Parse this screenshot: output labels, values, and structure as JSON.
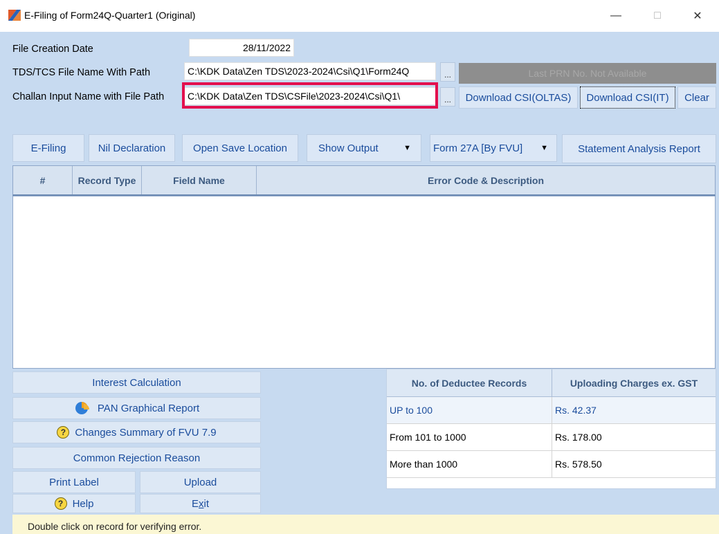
{
  "window": {
    "title": "E-Filing of Form24Q-Quarter1 (Original)",
    "min": "—",
    "max": "□",
    "close": "✕"
  },
  "form": {
    "file_creation_label": "File Creation Date",
    "file_creation_value": "28/11/2022",
    "tds_label": "TDS/TCS File Name With Path",
    "tds_value": "C:\\KDK Data\\Zen TDS\\2023-2024\\Csi\\Q1\\Form24Q",
    "challan_label": "Challan Input Name with File Path",
    "challan_value": "C:\\KDK Data\\Zen TDS\\CSFile\\2023-2024\\Csi\\Q1\\",
    "ellipsis": "...",
    "prn_text": "Last PRN No. Not Available",
    "download_oltas": "Download CSI(OLTAS)",
    "download_it": "Download CSI(IT)",
    "clear": "Clear"
  },
  "toolbar": {
    "efiling": "E-Filing",
    "nil": "Nil Declaration",
    "open_save": "Open Save Location",
    "show_output": "Show Output",
    "form27a": "Form 27A [By FVU]",
    "dropdown_arrow": "▼",
    "analysis": "Statement Analysis Report"
  },
  "grid": {
    "columns": [
      "#",
      "Record Type",
      "Field Name",
      "Error Code & Description"
    ]
  },
  "left_buttons": {
    "interest": "Interest Calculation",
    "pan": "PAN Graphical Report",
    "changes": "Changes Summary of FVU 7.9",
    "common": "Common Rejection Reason",
    "print_label": "Print Label",
    "upload": "Upload",
    "help": "Help",
    "exit_prefix": "E",
    "exit_accel": "x",
    "exit_suffix": "it",
    "q": "?"
  },
  "charges": {
    "headers": [
      "No. of Deductee Records",
      "Uploading Charges ex. GST"
    ],
    "rows": [
      {
        "range": "UP to 100",
        "charge": "Rs. 42.37"
      },
      {
        "range": "From 101 to 1000",
        "charge": "Rs. 178.00"
      },
      {
        "range": "More than 1000",
        "charge": "Rs. 578.50"
      }
    ]
  },
  "status": "Double click on record for verifying error.",
  "colors": {
    "highlight": "#e3104e",
    "accent": "#1a4c9c",
    "client_bg": "#c7daf0"
  }
}
